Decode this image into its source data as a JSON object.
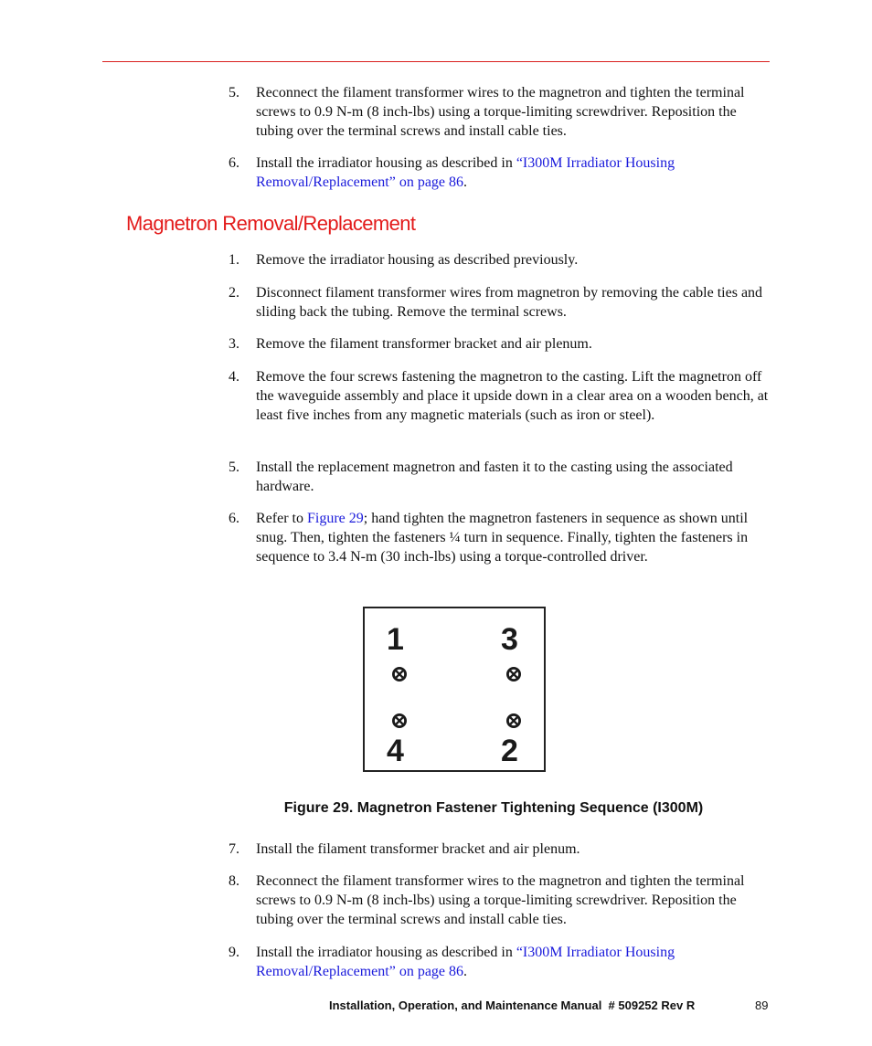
{
  "header": {
    "rule_color": "#d9201f"
  },
  "top_list": [
    {
      "number": "5.",
      "text": "Reconnect the filament transformer wires to the magnetron and tighten the terminal screws to 0.9 N-m (8 inch-lbs) using a torque-limiting screwdriver. Reposition the tubing over the terminal screws and install cable ties."
    },
    {
      "number": "6.",
      "text_before": "Install the irradiator housing as described in ",
      "link": "“I300M Irradiator Housing Removal/Replacement” on page 86",
      "text_after": "."
    }
  ],
  "section": {
    "heading": "Magnetron Removal/Replacement",
    "heading_color": "#e31b1b",
    "steps": [
      {
        "number": "1.",
        "text": "Remove the irradiator housing as described previously."
      },
      {
        "number": "2.",
        "text": "Disconnect filament transformer wires from magnetron by removing the cable ties and sliding back the tubing. Remove the terminal screws."
      },
      {
        "number": "3.",
        "text": "Remove the filament transformer bracket and air plenum."
      },
      {
        "number": "4.",
        "text": "Remove the four screws fastening the magnetron to the casting. Lift the magnetron off the waveguide assembly and place it upside down in a clear area on a wooden bench, at least five inches from any magnetic materials (such as iron or steel)."
      },
      {
        "number": "5.",
        "text": "Install the replacement magnetron and fasten it to the casting using the associated hardware."
      },
      {
        "number": "6.",
        "text_before": "Refer to ",
        "link": "Figure 29",
        "text_after": "; hand tighten the magnetron fasteners in sequence as shown until snug. Then, tighten the fasteners ¼ turn in sequence. Finally, tighten the fasteners in sequence to 3.4 N-m (30 inch-lbs) using a torque-controlled driver."
      }
    ],
    "figure": {
      "labels": {
        "top_left": "1",
        "top_right": "3",
        "bottom_left": "4",
        "bottom_right": "2"
      },
      "caption": "Figure 29. Magnetron Fastener Tightening Sequence (I300M)"
    },
    "steps_after": [
      {
        "number": "7.",
        "text": "Install the filament transformer bracket and air plenum."
      },
      {
        "number": "8.",
        "text": "Reconnect the filament transformer wires to the magnetron and tighten the terminal screws to 0.9 N-m (8 inch-lbs) using a torque-limiting screwdriver. Reposition the tubing over the terminal screws and install cable ties."
      },
      {
        "number": "9.",
        "text_before": "Install the irradiator housing as described in ",
        "link": "“I300M Irradiator Housing Removal/Replacement” on page 86",
        "text_after": "."
      }
    ]
  },
  "footer": {
    "title": "Installation, Operation, and Maintenance Manual  # 509252 Rev R",
    "page_number": "89"
  },
  "link_color": "#1a1adb"
}
